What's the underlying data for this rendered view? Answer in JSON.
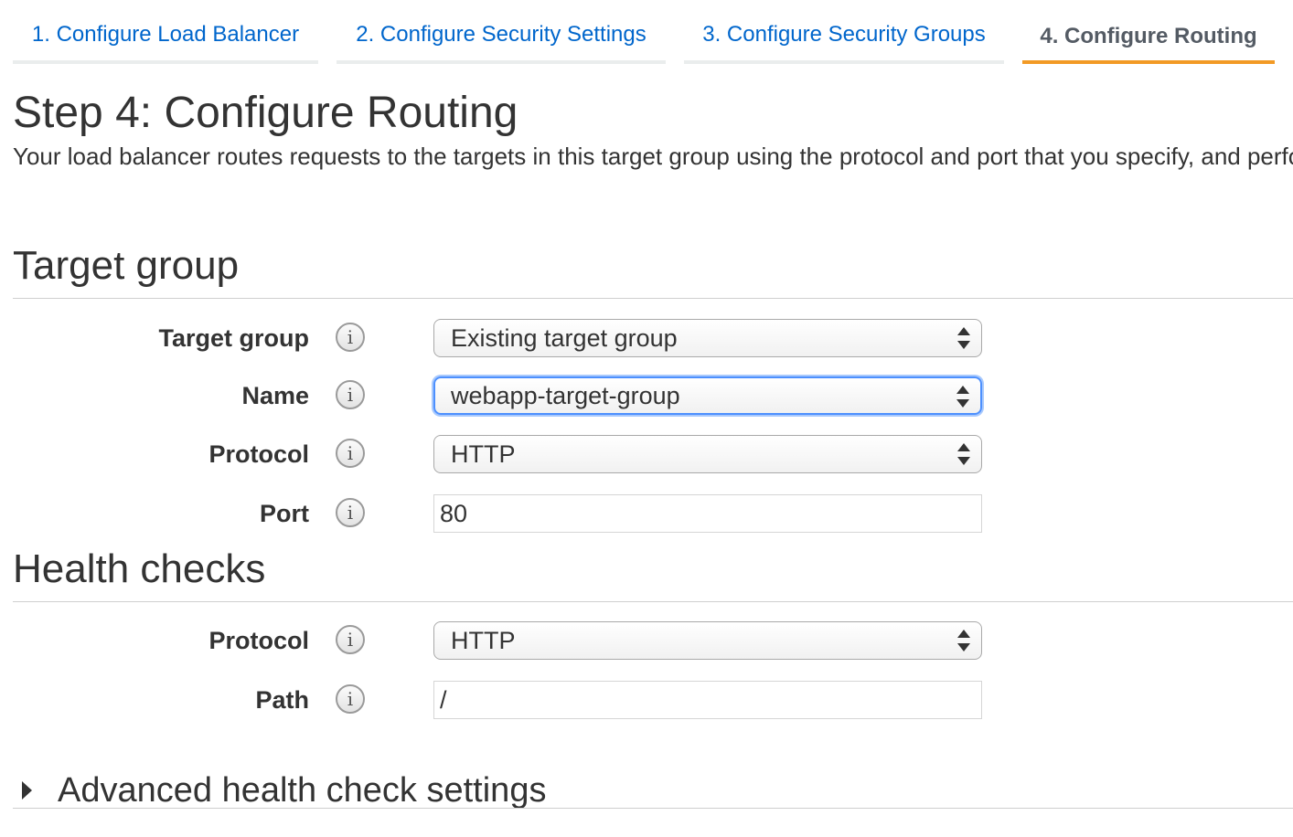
{
  "tabs": [
    {
      "label": "1. Configure Load Balancer",
      "active": false
    },
    {
      "label": "2. Configure Security Settings",
      "active": false
    },
    {
      "label": "3. Configure Security Groups",
      "active": false
    },
    {
      "label": "4. Configure Routing",
      "active": true
    }
  ],
  "page": {
    "title": "Step 4: Configure Routing",
    "description": "Your load balancer routes requests to the targets in this target group using the protocol and port that you specify, and performs health checks on the targets using these health check settings. Note that each target group can be associated with only one load balancer."
  },
  "target_group": {
    "title": "Target group",
    "fields": {
      "target_group": {
        "label": "Target group",
        "value": "Existing target group"
      },
      "name": {
        "label": "Name",
        "value": "webapp-target-group"
      },
      "protocol": {
        "label": "Protocol",
        "value": "HTTP"
      },
      "port": {
        "label": "Port",
        "value": "80"
      }
    }
  },
  "health_checks": {
    "title": "Health checks",
    "fields": {
      "protocol": {
        "label": "Protocol",
        "value": "HTTP"
      },
      "path": {
        "label": "Path",
        "value": "/"
      }
    }
  },
  "advanced": {
    "label": "Advanced health check settings"
  },
  "icons": {
    "info": "info-icon",
    "caret": "caret-right-icon",
    "select_arrows": "select-arrows-icon"
  },
  "colors": {
    "link": "#0066cc",
    "active_tab_underline": "#f29a25",
    "focus": "#4d90fe"
  }
}
